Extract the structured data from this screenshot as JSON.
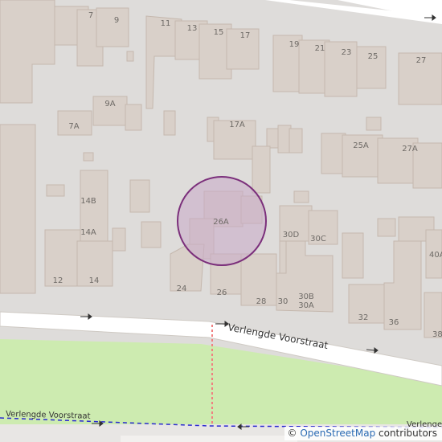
{
  "map": {
    "attribution": {
      "symbol": "©",
      "provider": "OpenStreetMap",
      "suffix": "contributors"
    },
    "streets": {
      "main": "Verlengde Voorstraat",
      "path": "Verlengde Voorstraat",
      "corner": "Verlenge"
    },
    "marker_label": "26A",
    "house_numbers": [
      "7",
      "9",
      "11",
      "13",
      "15",
      "17",
      "19",
      "21",
      "23",
      "25",
      "27",
      "9A",
      "7A",
      "17A",
      "25A",
      "27A",
      "14B",
      "14A",
      "12",
      "14",
      "24",
      "26",
      "28",
      "30",
      "30D",
      "30C",
      "30B",
      "30A",
      "32",
      "36",
      "38",
      "40A"
    ],
    "colors": {
      "background": "#dedcda",
      "building": "#d9d0c9",
      "building_stroke": "#c5b8ae",
      "road": "#ffffff",
      "grass": "#cdebb0",
      "marker_fill": "#c9a9c9",
      "marker_stroke": "#7b2f7b",
      "path_blue": "#2a2ad0",
      "footway": "#f08080"
    }
  }
}
